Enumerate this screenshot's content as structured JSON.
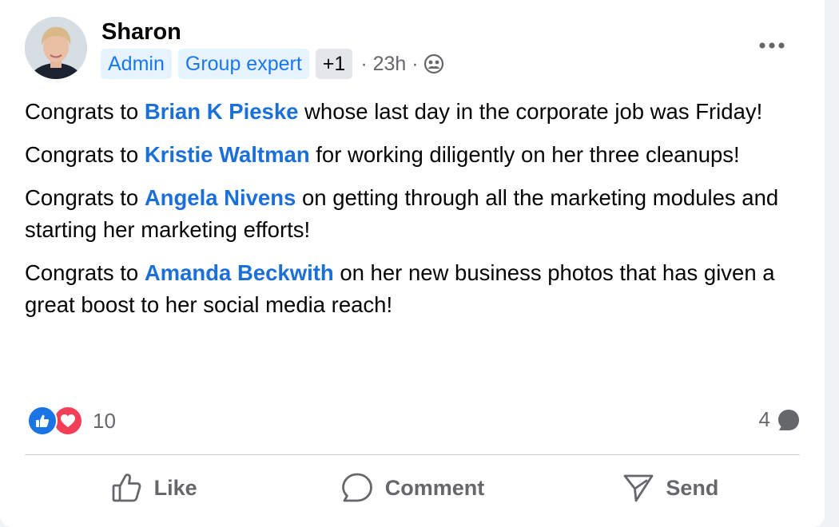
{
  "post": {
    "author": "Sharon",
    "badges": [
      "Admin",
      "Group expert",
      "+1"
    ],
    "time": "· 23h ·",
    "audience_icon": "group-globe-icon",
    "more_icon": "more-dots-icon",
    "paragraphs": [
      {
        "prefix": "Congrats to ",
        "mention": "Brian K Pieske",
        "suffix": " whose last day in the corporate job was Friday!"
      },
      {
        "prefix": "Congrats to ",
        "mention": "Kristie Waltman",
        "suffix": " for working diligently on her three cleanups!"
      },
      {
        "prefix": "Congrats to ",
        "mention": "Angela Nivens",
        "suffix": " on getting through all the marketing modules and starting her marketing efforts!"
      },
      {
        "prefix": "Congrats to ",
        "mention": "Amanda Beckwith",
        "suffix": " on her new business photos that has given a great boost to her social media reach!"
      }
    ]
  },
  "stats": {
    "reaction_count": "10",
    "comment_count": "4"
  },
  "actions": {
    "like": "Like",
    "comment": "Comment",
    "send": "Send"
  },
  "colors": {
    "mention": "#1b6fd8",
    "badge_bg": "#e7f3ff",
    "badge_text": "#1877f2",
    "like_reaction": "#1b74e4",
    "love_reaction": "#f33e58",
    "secondary_text": "#65676b"
  }
}
